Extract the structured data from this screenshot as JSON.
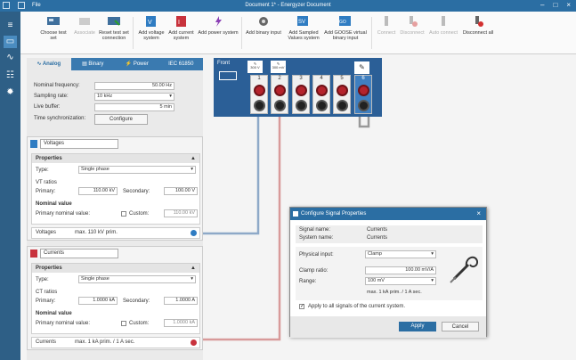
{
  "titlebar": {
    "file": "File",
    "title": "Document 1* - Energyzer Document"
  },
  "ribbon": {
    "choose_test_set": "Choose test set",
    "associate": "Associate",
    "reset_test_set_1": "Reset test set",
    "reset_test_set_2": "connection",
    "add_voltage_1": "Add voltage",
    "add_voltage_2": "system",
    "add_current_1": "Add current",
    "add_current_2": "system",
    "add_power": "Add power system",
    "add_binary_input": "Add binary input",
    "add_sv_1": "Add Sampled",
    "add_sv_2": "Values system",
    "add_goose_1": "Add GOOSE virtual",
    "add_goose_2": "binary input",
    "connect": "Connect",
    "disconnect": "Disconnect",
    "auto_connect": "Auto connect",
    "disconnect_all": "Disconnect all"
  },
  "tabs": {
    "analog": "Analog",
    "binary": "Binary",
    "power": "Power",
    "iec": "IEC 61850"
  },
  "analog": {
    "nominal_frequency_label": "Nominal frequency:",
    "nominal_frequency_value": "50.00 Hz",
    "sampling_rate_label": "Sampling rate:",
    "sampling_rate_value": "10 kHz",
    "live_buffer_label": "Live buffer:",
    "live_buffer_value": "5 min",
    "time_sync_label": "Time synchronization:",
    "configure_button": "Configure"
  },
  "voltages": {
    "name": "Voltages",
    "properties": "Properties",
    "type_label": "Type:",
    "type_value": "Single phase",
    "ratios_label": "VT ratios",
    "primary_label": "Primary:",
    "primary_value": "110.00 kV",
    "secondary_label": "Secondary:",
    "secondary_value": "100.00 V",
    "nominal_label": "Nominal value",
    "pnv_label": "Primary nominal value:",
    "custom_label": "Custom:",
    "custom_value": "110.00 kV",
    "summary_name": "Voltages",
    "summary_value": "max. 110 kV prim."
  },
  "currents": {
    "name": "Currents",
    "properties": "Properties",
    "type_label": "Type:",
    "type_value": "Single phase",
    "ratios_label": "CT ratios",
    "primary_label": "Primary:",
    "primary_value": "1.0000 kA",
    "secondary_label": "Secondary:",
    "secondary_value": "1.0000 A",
    "nominal_label": "Nominal value",
    "pnv_label": "Primary nominal value:",
    "custom_label": "Custom:",
    "custom_value": "1.0000 kA",
    "summary_name": "Currents",
    "summary_value": "max. 1 kA prim. / 1 A sec."
  },
  "front": {
    "label": "Front",
    "rating_1": "300 V",
    "rating_2": "300 mV",
    "channels": [
      "1",
      "2",
      "3",
      "4",
      "5",
      "6"
    ]
  },
  "dialog": {
    "title": "Configure Signal Properties",
    "signal_name_label": "Signal name:",
    "signal_name_value": "Currents",
    "system_name_label": "System name:",
    "system_name_value": "Currents",
    "physical_input_label": "Physical input:",
    "physical_input_value": "Clamp",
    "clamp_ratio_label": "Clamp ratio:",
    "clamp_ratio_value": "100.00 mV/A",
    "range_label": "Range:",
    "range_value": "100 mV",
    "range_note": "max. 1 kA prim. / 1 A sec.",
    "apply_all_label": "Apply to all signals of the current system.",
    "apply_button": "Apply",
    "cancel_button": "Cancel"
  },
  "colors": {
    "accent": "#2b6ea3",
    "voltage": "#8ea9c8",
    "current": "#c04848",
    "dark_blue": "#2b5f97"
  }
}
